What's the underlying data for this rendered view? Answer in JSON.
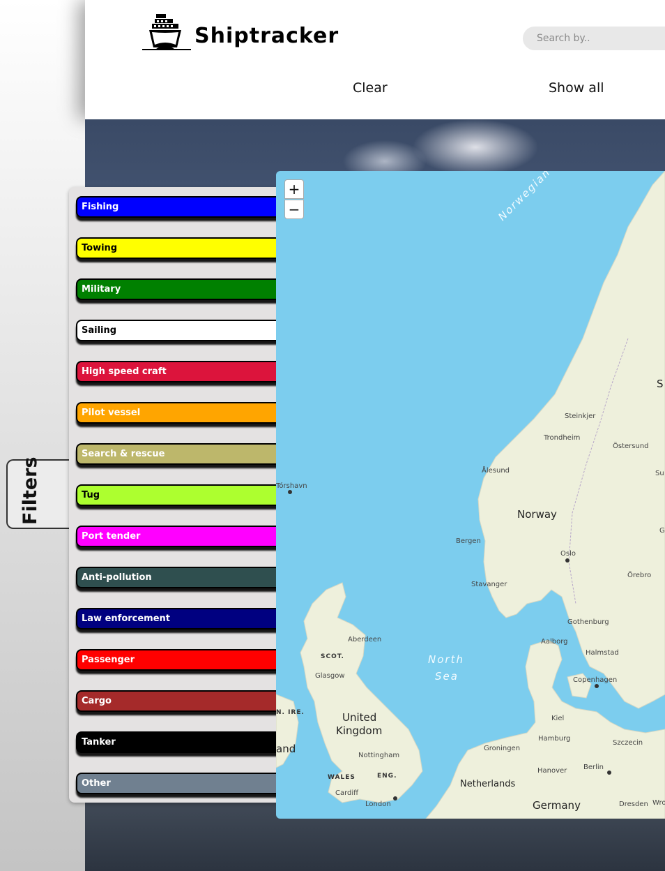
{
  "app": {
    "name": "Shiptracker"
  },
  "search": {
    "placeholder": "Search by.."
  },
  "nav": {
    "clear_label": "Clear",
    "show_all_label": "Show all"
  },
  "filters": {
    "tab_label": "Filters",
    "items": [
      {
        "label": "Fishing",
        "color": "#0000ff",
        "text_color": "#ffffff"
      },
      {
        "label": "Towing",
        "color": "#ffff00",
        "text_color": "#000000"
      },
      {
        "label": "Military",
        "color": "#008000",
        "text_color": "#ffffff"
      },
      {
        "label": "Sailing",
        "color": "#ffffff",
        "text_color": "#000000"
      },
      {
        "label": "High speed craft",
        "color": "#dc143c",
        "text_color": "#ffffff"
      },
      {
        "label": "Pilot vessel",
        "color": "#ffa500",
        "text_color": "#ffffff"
      },
      {
        "label": "Search & rescue",
        "color": "#bdb76b",
        "text_color": "#ffffff"
      },
      {
        "label": "Tug",
        "color": "#adff2f",
        "text_color": "#000000"
      },
      {
        "label": "Port tender",
        "color": "#ff00ff",
        "text_color": "#ffffff"
      },
      {
        "label": "Anti-pollution",
        "color": "#2f4f4f",
        "text_color": "#ffffff"
      },
      {
        "label": "Law enforcement",
        "color": "#000080",
        "text_color": "#ffffff"
      },
      {
        "label": "Passenger",
        "color": "#ff0000",
        "text_color": "#ffffff"
      },
      {
        "label": "Cargo",
        "color": "#a52a2a",
        "text_color": "#ffffff"
      },
      {
        "label": "Tanker",
        "color": "#000000",
        "text_color": "#ffffff"
      },
      {
        "label": "Other",
        "color": "#708090",
        "text_color": "#ffffff"
      }
    ]
  },
  "map": {
    "zoom_in_label": "+",
    "zoom_out_label": "−",
    "sea_color": "#7ccdee",
    "land_color": "#eef0dc",
    "labels": {
      "norwegian_sea": "Norwegian",
      "north_sea_1": "North",
      "north_sea_2": "Sea",
      "norway": "Norway",
      "united": "United",
      "kingdom": "Kingdom",
      "netherlands": "Netherlands",
      "germany": "Germany",
      "scot": "SCOT.",
      "n_ire": "N. IRE.",
      "wales": "WALES",
      "eng": "ENG.",
      "ireland_part": "and",
      "steinkjer": "Steinkjer",
      "trondheim": "Trondheim",
      "ostersund": "Östersund",
      "alesund": "Ålesund",
      "torshavn": "Tórshavn",
      "bergen": "Bergen",
      "oslo": "Oslo",
      "orebro": "Örebro",
      "stavanger": "Stavanger",
      "gothenburg": "Gothenburg",
      "aalborg": "Aalborg",
      "halmstad": "Halmstad",
      "copenhagen": "Copenhagen",
      "aberdeen": "Aberdeen",
      "glasgow": "Glasgow",
      "kiel": "Kiel",
      "hamburg": "Hamburg",
      "szczecin": "Szczecin",
      "groningen": "Groningen",
      "nottingham": "Nottingham",
      "hanover": "Hanover",
      "berlin": "Berlin",
      "cardiff": "Cardiff",
      "london": "London",
      "dresden": "Dresden",
      "wro": "Wro",
      "s_edge": "S",
      "su_edge": "Su",
      "g_edge": "G"
    }
  }
}
